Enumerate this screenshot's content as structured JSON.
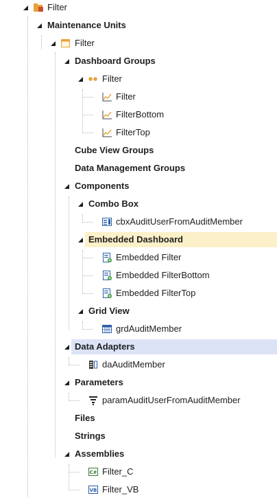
{
  "tree": {
    "root_label": "Filter",
    "maintenance_units_label": "Maintenance Units",
    "unit_label": "Filter",
    "dashboard_groups_label": "Dashboard Groups",
    "dashboard_group_label": "Filter",
    "dashboards": [
      "Filter",
      "FilterBottom",
      "FilterTop"
    ],
    "cube_view_groups_label": "Cube View Groups",
    "data_management_groups_label": "Data Management Groups",
    "components_label": "Components",
    "combo_box_label": "Combo Box",
    "combo_box_items": [
      "cbxAuditUserFromAuditMember"
    ],
    "embedded_dashboard_label": "Embedded Dashboard",
    "embedded_dashboard_items": [
      "Embedded Filter",
      "Embedded FilterBottom",
      "Embedded FilterTop"
    ],
    "grid_view_label": "Grid View",
    "grid_view_items": [
      "grdAuditMember"
    ],
    "data_adapters_label": "Data Adapters",
    "data_adapter_items": [
      "daAuditMember"
    ],
    "parameters_label": "Parameters",
    "parameter_items": [
      "paramAuditUserFromAuditMember"
    ],
    "files_label": "Files",
    "strings_label": "Strings",
    "assemblies_label": "Assemblies",
    "assembly_items": [
      "Filter_C",
      "Filter_VB"
    ]
  },
  "colors": {
    "selected_row": "#fcf0c8",
    "hover_row": "#dde3f7",
    "folder_orange": "#e8a23a",
    "accent_blue": "#2a5ea8"
  }
}
